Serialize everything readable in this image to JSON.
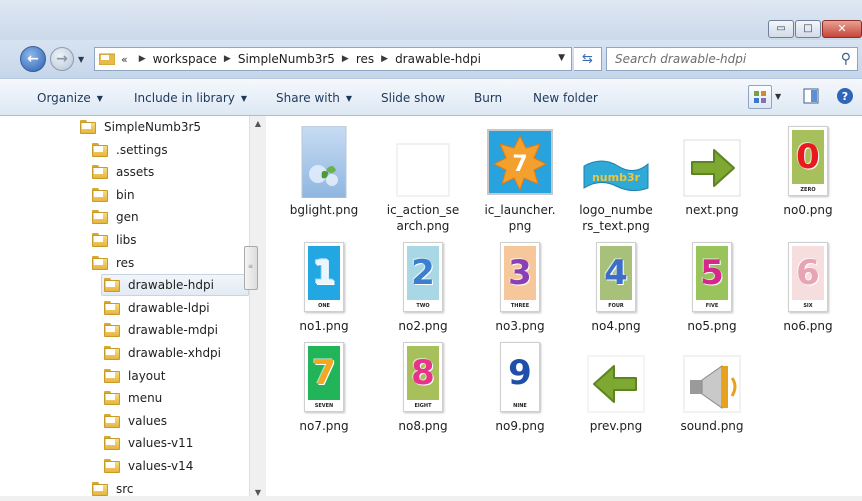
{
  "window": {
    "minimize_glyph": "▭",
    "maximize_glyph": "□",
    "close_glyph": "✕"
  },
  "address": {
    "overflow": "«",
    "breadcrumb": [
      "workspace",
      "SimpleNumb3r5",
      "res",
      "drawable-hdpi"
    ],
    "search_placeholder": "Search drawable-hdpi"
  },
  "commands": [
    "Organize",
    "Include in library",
    "Share with",
    "Slide show",
    "Burn",
    "New folder"
  ],
  "tree": {
    "root": "SimpleNumb3r5",
    "items": [
      ".settings",
      "assets",
      "bin",
      "gen",
      "libs",
      "res"
    ],
    "res_children": [
      "drawable-hdpi",
      "drawable-ldpi",
      "drawable-mdpi",
      "drawable-xhdpi",
      "layout",
      "menu",
      "values",
      "values-v11",
      "values-v14"
    ],
    "tail": [
      "src"
    ],
    "selected": "drawable-hdpi"
  },
  "files": [
    {
      "name": "bglight.png",
      "kind": "bglight"
    },
    {
      "name": "ic_action_search.png",
      "kind": "blank"
    },
    {
      "name": "ic_launcher.png",
      "kind": "launcher",
      "digit": "7"
    },
    {
      "name": "logo_numbers_text.png",
      "kind": "logo",
      "text": "numb3r"
    },
    {
      "name": "next.png",
      "kind": "next"
    },
    {
      "name": "no0.png",
      "kind": "num",
      "digit": "0",
      "word": "ZERO",
      "bg": "#a8c05c",
      "fg": "#e8191f"
    },
    {
      "name": "no1.png",
      "kind": "num",
      "digit": "1",
      "word": "ONE",
      "bg": "#22a7e3",
      "fg": "#e9f6ff"
    },
    {
      "name": "no2.png",
      "kind": "num",
      "digit": "2",
      "word": "TWO",
      "bg": "#a8d7e6",
      "fg": "#3b7fd1"
    },
    {
      "name": "no3.png",
      "kind": "num",
      "digit": "3",
      "word": "THREE",
      "bg": "#f6c79a",
      "fg": "#8a3fb5"
    },
    {
      "name": "no4.png",
      "kind": "num",
      "digit": "4",
      "word": "FOUR",
      "bg": "#a7c07a",
      "fg": "#3c6ec9"
    },
    {
      "name": "no5.png",
      "kind": "num",
      "digit": "5",
      "word": "FIVE",
      "bg": "#98c45b",
      "fg": "#d6288b"
    },
    {
      "name": "no6.png",
      "kind": "num",
      "digit": "6",
      "word": "SIX",
      "bg": "#f7dede",
      "fg": "#e6a4b6"
    },
    {
      "name": "no7.png",
      "kind": "num",
      "digit": "7",
      "word": "SEVEN",
      "bg": "#21b458",
      "fg": "#f5a623"
    },
    {
      "name": "no8.png",
      "kind": "num",
      "digit": "8",
      "word": "EIGHT",
      "bg": "#a7c05b",
      "fg": "#e8338c"
    },
    {
      "name": "no9.png",
      "kind": "num",
      "digit": "9",
      "word": "NINE",
      "bg": "#ffffff",
      "fg": "#1f4fa8"
    },
    {
      "name": "prev.png",
      "kind": "prev"
    },
    {
      "name": "sound.png",
      "kind": "sound"
    }
  ]
}
